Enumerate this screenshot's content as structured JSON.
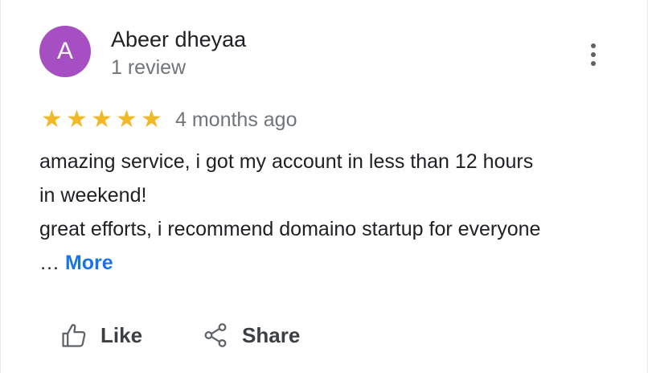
{
  "reviewer": {
    "initial": "A",
    "name": "Abeer dheyaa",
    "review_count": "1 review",
    "avatar_color": "#a64fc2"
  },
  "review": {
    "rating": 5,
    "rating_max": 5,
    "star_glyph": "★",
    "time": "4 months ago",
    "lines": [
      "amazing service, i got my account in less than 12 hours",
      "in weekend!",
      "great efforts, i recommend domaino startup for everyone"
    ],
    "ellipsis": "…",
    "more_label": "More"
  },
  "actions": {
    "like_label": "Like",
    "share_label": "Share"
  },
  "icons": {
    "menu": "more-vert-icon",
    "like": "thumbs-up-icon",
    "share": "share-icon"
  },
  "colors": {
    "star": "#f2b827",
    "link": "#1a73e8",
    "secondary_text": "#70757a"
  }
}
